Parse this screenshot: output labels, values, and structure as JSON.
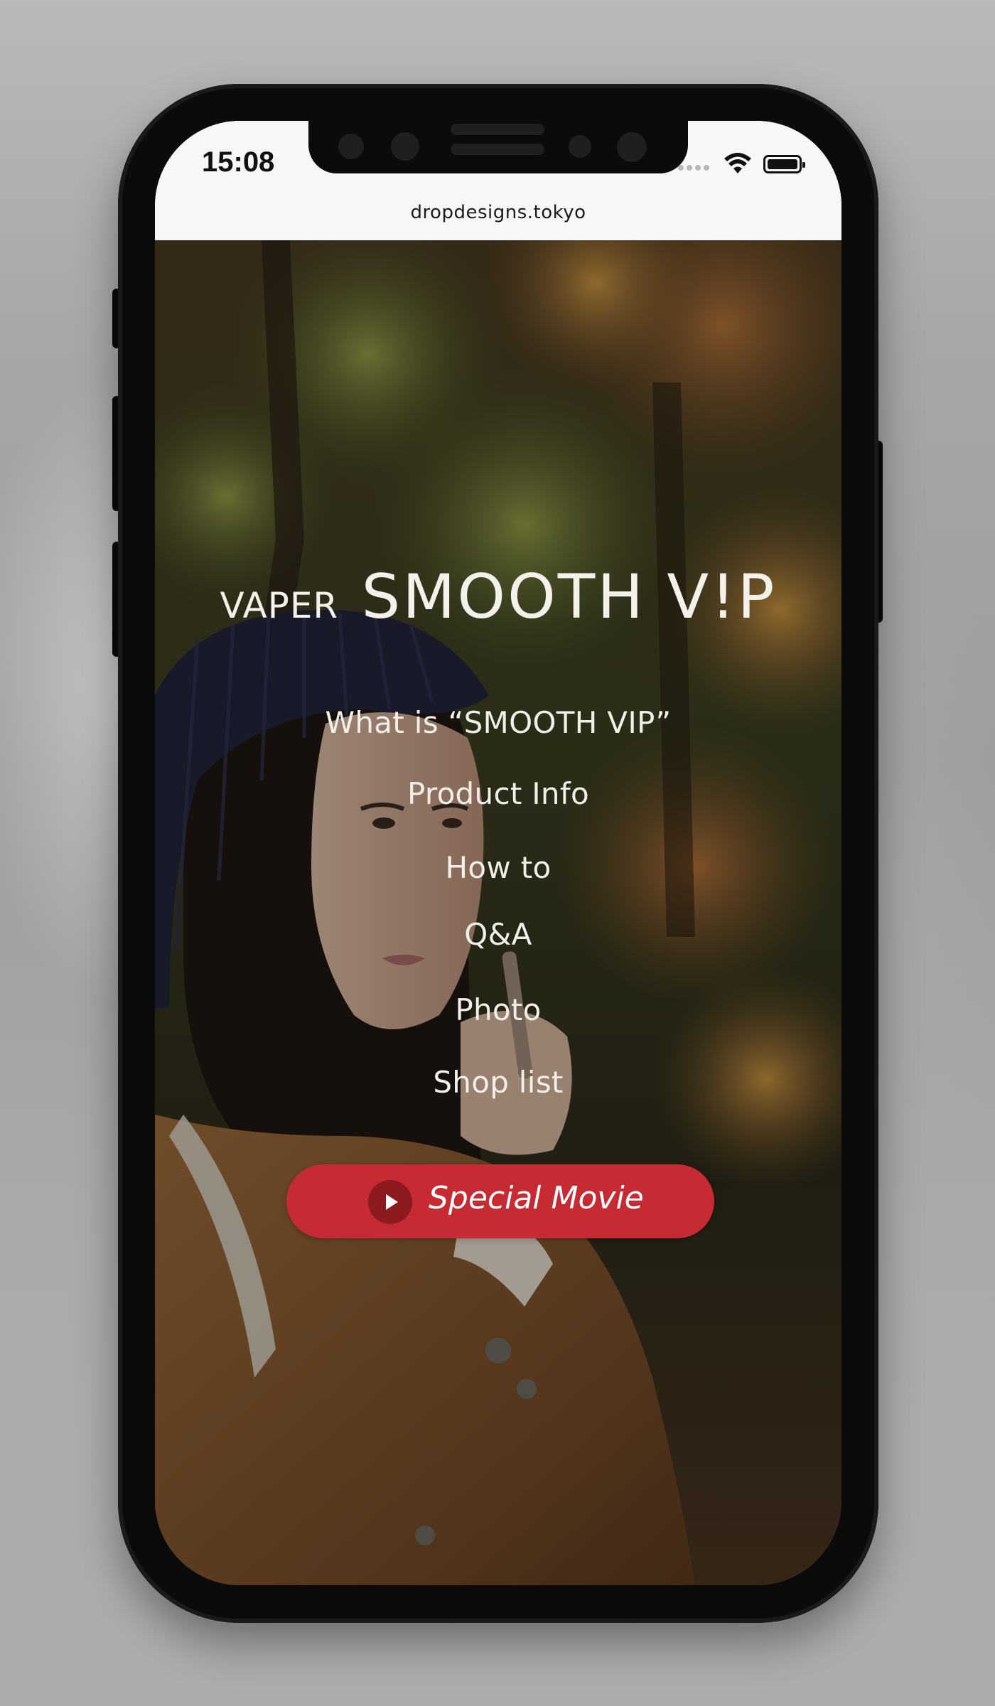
{
  "status_bar": {
    "time": "15:08",
    "icons": [
      "signal-dots-icon",
      "wifi-icon",
      "battery-icon"
    ]
  },
  "browser": {
    "url": "dropdesigns.tokyo"
  },
  "site": {
    "logo_small": "VAPER",
    "logo_big": "SMOOTH V!P",
    "nav": [
      {
        "label": "What is “SMOOTH VIP”"
      },
      {
        "label": "Product Info"
      },
      {
        "label": "How to"
      },
      {
        "label": "Q&A"
      },
      {
        "label": "Photo"
      },
      {
        "label": "Shop list"
      }
    ],
    "cta": {
      "label": "Special Movie",
      "icon": "play-icon",
      "color": "#c62a33"
    }
  },
  "colors": {
    "background": "#a9a9a9",
    "phone_frame": "#0b0b0b",
    "nav_text": "#f2efe8"
  }
}
